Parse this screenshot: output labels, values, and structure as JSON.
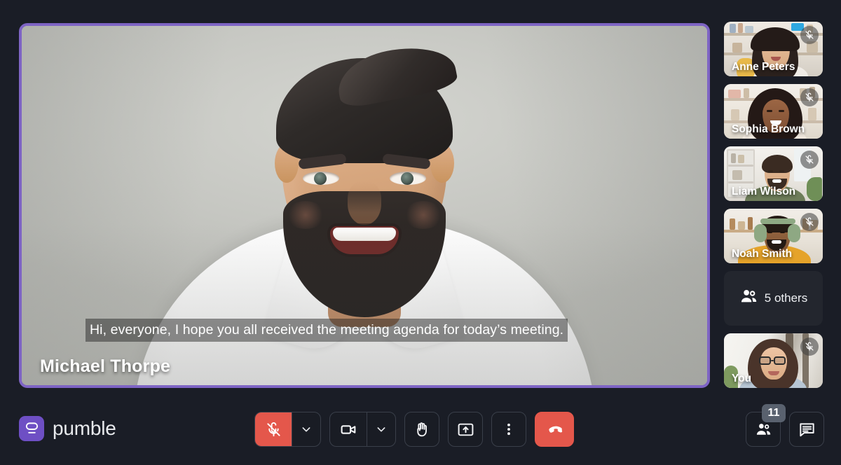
{
  "app": {
    "brand_name": "pumble",
    "brand_icon": "pumble-logo-icon",
    "background_color": "#1a1d26",
    "accent_color": "#6e4fc4",
    "danger_color": "#e4574b",
    "active_speaker_border_color": "#7e64c4"
  },
  "stage": {
    "speaker_name": "Michael Thorpe",
    "caption": "Hi, everyone, I hope you all received the meeting agenda for today’s meeting.",
    "is_active_speaker": true
  },
  "rail": {
    "participants": [
      {
        "name": "Anne Peters",
        "muted": true,
        "mic_icon": "mic-muted-icon"
      },
      {
        "name": "Sophia Brown",
        "muted": true,
        "mic_icon": "mic-muted-icon"
      },
      {
        "name": "Liam Wilson",
        "muted": true,
        "mic_icon": "mic-muted-icon"
      },
      {
        "name": "Noah Smith",
        "muted": true,
        "mic_icon": "mic-muted-icon"
      }
    ],
    "others": {
      "label": "5 others",
      "icon": "people-icon",
      "count": 5
    },
    "self": {
      "name": "You",
      "muted": true,
      "mic_icon": "mic-muted-icon"
    }
  },
  "controls": {
    "microphone": {
      "icon": "mic-muted-icon",
      "state": "muted",
      "caret_icon": "chevron-down-icon"
    },
    "camera": {
      "icon": "video-camera-icon",
      "state": "on",
      "caret_icon": "chevron-down-icon"
    },
    "raise_hand": {
      "icon": "raised-hand-icon"
    },
    "share_screen": {
      "icon": "share-screen-icon"
    },
    "more_options": {
      "icon": "more-vertical-icon"
    },
    "end_call": {
      "icon": "end-call-icon"
    }
  },
  "right_controls": {
    "participants": {
      "icon": "people-icon",
      "badge": "11"
    },
    "chat": {
      "icon": "chat-bubble-icon"
    }
  }
}
